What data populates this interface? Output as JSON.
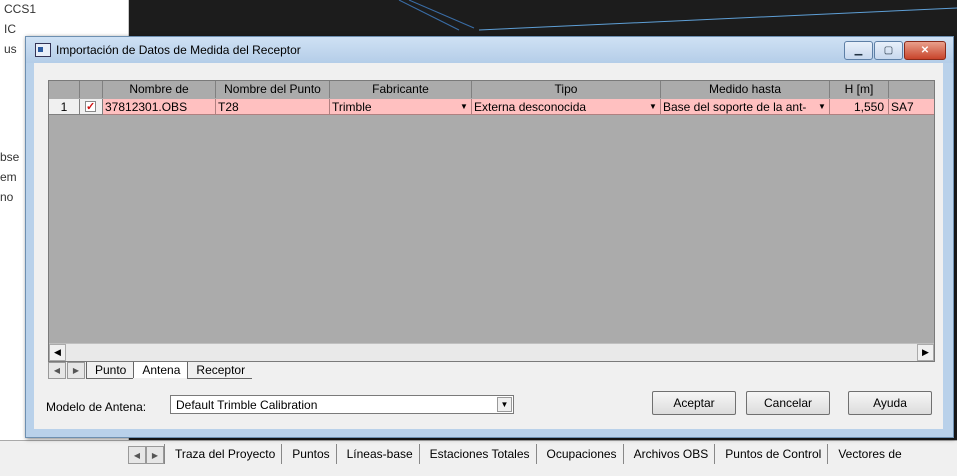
{
  "background": {
    "left_texts": [
      "CCS1",
      "IC",
      "us",
      "bse",
      "em",
      "no"
    ],
    "tabs": [
      "Traza del Proyecto",
      "Puntos",
      "Líneas-base",
      "Estaciones Totales",
      "Ocupaciones",
      "Archivos OBS",
      "Puntos de Control",
      "Vectores de"
    ]
  },
  "dialog": {
    "title": "Importación de Datos de Medida del Receptor",
    "columns": [
      "",
      "",
      "Nombre de",
      "Nombre del Punto",
      "Fabricante",
      "Tipo",
      "Medido hasta",
      "H [m]",
      ""
    ],
    "rows": [
      {
        "num": "1",
        "checked": true,
        "file": "37812301.OBS",
        "point": "T28",
        "maker": "Trimble",
        "type": "Externa desconocida",
        "measured_to": "Base del soporte de la ant‐",
        "height": "1,550",
        "extra": "SA7"
      }
    ],
    "sheet_tabs": [
      "Punto",
      "Antena",
      "Receptor"
    ],
    "active_tab": "Antena",
    "antenna_model_label": "Modelo de Antena:",
    "antenna_model_value": "Default Trimble Calibration",
    "buttons": {
      "accept": "Aceptar",
      "cancel": "Cancelar",
      "help": "Ayuda"
    }
  },
  "colors": {
    "selected_row": "#ffc0c0",
    "titlebar": "#b9d1ea",
    "close": "#c8442b"
  }
}
